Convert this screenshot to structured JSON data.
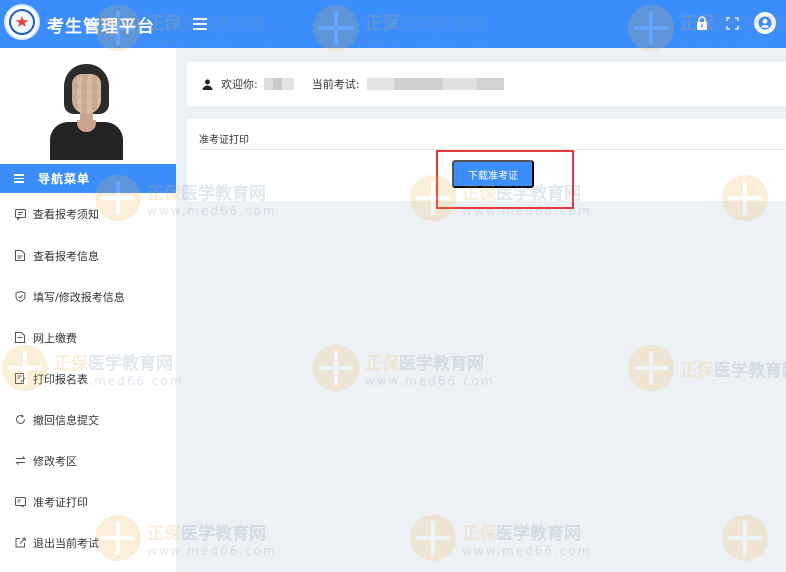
{
  "header": {
    "title": "考生管理平台"
  },
  "sidebar": {
    "nav_title": "导航菜单",
    "items": [
      {
        "label": "查看报考须知",
        "icon": "notice-icon"
      },
      {
        "label": "查看报考信息",
        "icon": "document-icon"
      },
      {
        "label": "填写/修改报考信息",
        "icon": "shield-check-icon"
      },
      {
        "label": "网上缴费",
        "icon": "payment-icon"
      },
      {
        "label": "打印报名表",
        "icon": "print-form-icon"
      },
      {
        "label": "撤回信息提交",
        "icon": "undo-icon"
      },
      {
        "label": "修改考区",
        "icon": "swap-icon"
      },
      {
        "label": "准考证打印",
        "icon": "admission-card-icon"
      },
      {
        "label": "退出当前考试",
        "icon": "exit-icon"
      }
    ]
  },
  "main": {
    "welcome_label": "欢迎你:",
    "exam_label": "当前考试:",
    "card_title": "准考证打印",
    "download_button": "下载准考证"
  },
  "watermark": {
    "brand_1": "正保",
    "brand_2": "医学教育网",
    "url": "www.med66.com"
  },
  "colors": {
    "primary": "#3c8dfc",
    "highlight": "#e23a3a",
    "background": "#edf1f6"
  }
}
